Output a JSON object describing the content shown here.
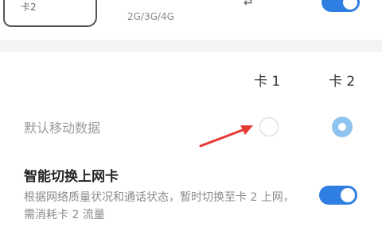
{
  "top_section": {
    "sim_label": "卡2",
    "network_types": "2G/3G/4G",
    "toggle_on": true
  },
  "dual_card": {
    "column_headers": [
      "卡 1",
      "卡 2"
    ],
    "default_data": {
      "label": "默认移动数据",
      "selected_card": 2
    },
    "smart_switch": {
      "title": "智能切换上网卡",
      "description": "根据网络质量状况和通话状态，暂时切换至卡 2 上网，需消耗卡 2 流量",
      "toggle_on": true
    }
  },
  "colors": {
    "accent": "#2f7fe3",
    "radio_selected": "#8ec2ef",
    "annotation_arrow": "#e53935"
  }
}
